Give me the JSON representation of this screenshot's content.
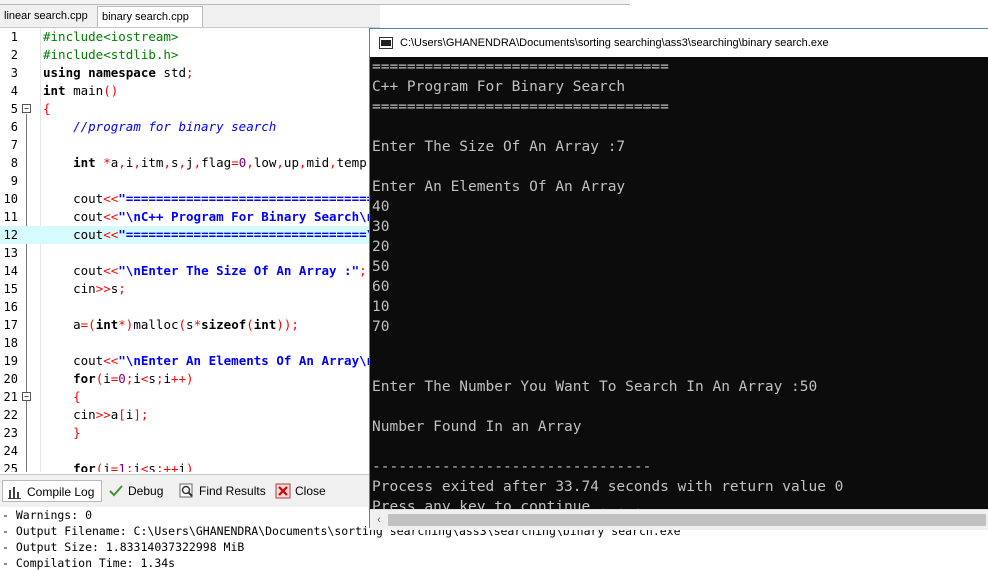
{
  "editor": {
    "tabs": [
      "linear search.cpp",
      "binary search.cpp"
    ],
    "active_tab": 1,
    "lines": [
      {
        "num": "1",
        "html": "<span class='p'>#include&lt;iostream&gt;</span>"
      },
      {
        "num": "2",
        "html": "<span class='p'>#include&lt;stdlib.h&gt;</span>"
      },
      {
        "num": "3",
        "html": "<span class='k'>using namespace</span> std<span class='o'>;</span>"
      },
      {
        "num": "4",
        "html": "<span class='k'>int</span> main<span class='o'>()</span>"
      },
      {
        "num": "5",
        "html": "<span class='o'>{</span>",
        "fold": true
      },
      {
        "num": "6",
        "html": "    <span class='c'>//program for binary search</span>"
      },
      {
        "num": "7",
        "html": ""
      },
      {
        "num": "8",
        "html": "    <span class='k'>int</span> <span class='o'>*</span>a<span class='o'>,</span>i<span class='o'>,</span>itm<span class='o'>,</span>s<span class='o'>,</span>j<span class='o'>,</span>flag<span class='o'>=</span><span class='n'>0</span><span class='o'>,</span>low<span class='o'>,</span>up<span class='o'>,</span>mid<span class='o'>,</span>temp<span class='o'>;</span>"
      },
      {
        "num": "9",
        "html": ""
      },
      {
        "num": "10",
        "html": "    cout<span class='o'>&lt;&lt;</span><span class='s'>\"====================================\"</span><span class='o'>;</span>"
      },
      {
        "num": "11",
        "html": "    cout<span class='o'>&lt;&lt;</span><span class='s'>\"\\nC++ Program For Binary Search\\n\"</span><span class='o'>;</span>"
      },
      {
        "num": "12",
        "html": "    cout<span class='o'>&lt;&lt;</span><span class='s'>\"================================\\n\"</span><span class='o'>;</span>",
        "hl": true
      },
      {
        "num": "13",
        "html": ""
      },
      {
        "num": "14",
        "html": "    cout<span class='o'>&lt;&lt;</span><span class='s'>\"\\nEnter The Size Of An Array :\"</span><span class='o'>;</span>"
      },
      {
        "num": "15",
        "html": "    cin<span class='o'>&gt;&gt;</span>s<span class='o'>;</span>"
      },
      {
        "num": "16",
        "html": ""
      },
      {
        "num": "17",
        "html": "    a<span class='o'>=(</span><span class='k'>int</span><span class='o'>*)</span>malloc<span class='o'>(</span>s<span class='o'>*</span><span class='k'>sizeof</span><span class='o'>(</span><span class='k'>int</span><span class='o'>));</span>"
      },
      {
        "num": "18",
        "html": ""
      },
      {
        "num": "19",
        "html": "    cout<span class='o'>&lt;&lt;</span><span class='s'>\"\\nEnter An Elements Of An Array\\n\"</span><span class='o'>;</span>"
      },
      {
        "num": "20",
        "html": "    <span class='k'>for</span><span class='o'>(</span>i<span class='o'>=</span><span class='n'>0</span><span class='o'>;</span>i<span class='o'>&lt;</span>s<span class='o'>;</span>i<span class='o'>++)</span>"
      },
      {
        "num": "21",
        "html": "    <span class='o'>{</span>",
        "fold": true
      },
      {
        "num": "22",
        "html": "    cin<span class='o'>&gt;&gt;</span>a<span class='o'>[</span>i<span class='o'>];</span>"
      },
      {
        "num": "23",
        "html": "    <span class='o'>}</span>"
      },
      {
        "num": "24",
        "html": ""
      },
      {
        "num": "25",
        "html": "    <span class='k'>for</span><span class='o'>(</span>i<span class='o'>=</span><span class='n'>1</span><span class='o'>;</span>i<span class='o'>&lt;</span>s<span class='o'>;++</span>i<span class='o'>)</span>"
      }
    ]
  },
  "bottom_tabs": [
    "Compile Log",
    "Debug",
    "Find Results",
    "Close"
  ],
  "log": [
    "- Warnings: 0",
    "- Output Filename: C:\\Users\\GHANENDRA\\Documents\\sorting searching\\ass3\\searching\\binary search.exe",
    "- Output Size: 1.83314037322998 MiB",
    "- Compilation Time: 1.34s"
  ],
  "console": {
    "title": "C:\\Users\\GHANENDRA\\Documents\\sorting searching\\ass3\\searching\\binary search.exe",
    "lines": [
      "==================================",
      "C++ Program For Binary Search",
      "==================================",
      "",
      "Enter The Size Of An Array :7",
      "",
      "Enter An Elements Of An Array",
      "40",
      "30",
      "20",
      "50",
      "60",
      "10",
      "70",
      "",
      "",
      "Enter The Number You Want To Search In An Array :50",
      "",
      "Number Found In an Array",
      "",
      "--------------------------------",
      "Process exited after 33.74 seconds with return value 0",
      "Press any key to continue . . ."
    ]
  },
  "colors": {
    "console_bg": "#0c0c0c",
    "console_text": "#c0c0c0",
    "highlight_line": "#d6fbfd",
    "preprocessor": "#008000",
    "string": "#0000ff",
    "operator": "#ff0000",
    "number": "#800080"
  },
  "icons": {
    "compile_log": "bar-chart-icon",
    "debug": "check-icon",
    "find_results": "magnifier-icon",
    "close": "close-icon"
  }
}
